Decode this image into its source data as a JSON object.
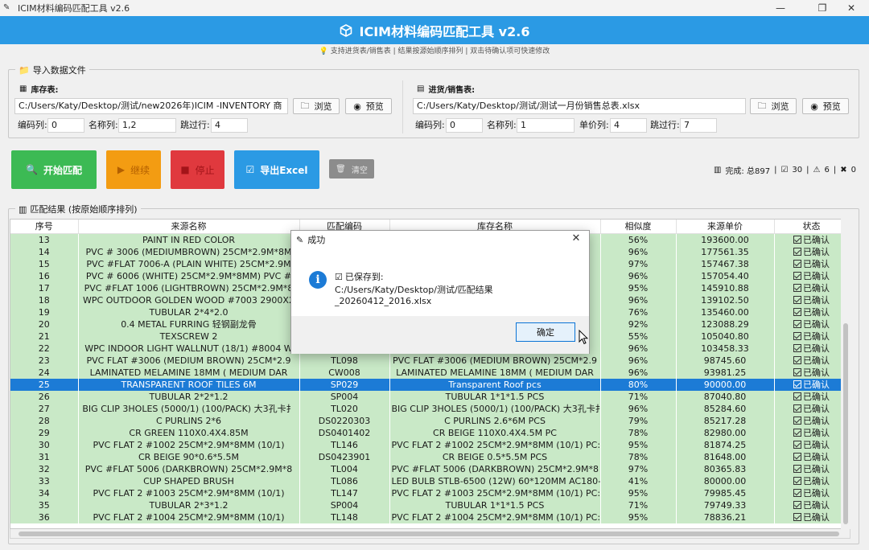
{
  "window": {
    "title": "ICIM材料编码匹配工具 v2.6",
    "minimize": "—",
    "maximize": "❐",
    "close": "✕"
  },
  "header": {
    "title": "ICIM材料编码匹配工具 v2.6",
    "subtitle": "💡 支持进货表/销售表 | 结果按源始顺序排列 | 双击待确认项可快速修改",
    "accent_color": "#2b9ae4"
  },
  "import": {
    "group_title": "导入数据文件",
    "inventory": {
      "label": "库存表:",
      "path": "C:/Users/Katy/Desktop/测试/new2026年)ICIM -INVENTORY 商",
      "browse": "浏览",
      "preview": "预览",
      "code_col_label": "编码列:",
      "code_col": "0",
      "name_col_label": "名称列:",
      "name_col": "1,2",
      "skip_label": "跳过行:",
      "skip": "4"
    },
    "sales": {
      "label": "进货/销售表:",
      "path": "C:/Users/Katy/Desktop/测试/测试一月份销售总表.xlsx",
      "browse": "浏览",
      "preview": "预览",
      "code_col_label": "编码列:",
      "code_col": "0",
      "name_col_label": "名称列:",
      "name_col": "1",
      "price_col_label": "单价列:",
      "price_col": "4",
      "skip_label": "跳过行:",
      "skip": "7"
    }
  },
  "actions": {
    "start": "开始匹配",
    "continue": "继续",
    "stop": "停止",
    "export": "导出Excel",
    "clear": "清空",
    "colors": {
      "start": "#3cba54",
      "continue": "#f39c12",
      "stop": "#e0393e",
      "export": "#2b9ae4",
      "clear": "#8c8c8c"
    }
  },
  "status": {
    "complete_label": "完成: 总897",
    "confirmed": "30",
    "warning": "6",
    "rejected": "0"
  },
  "results": {
    "group_title": "匹配结果 (按原始顺序排列)",
    "columns": [
      "序号",
      "来源名称",
      "匹配编码",
      "库存名称",
      "相似度",
      "来源单价",
      "状态"
    ],
    "status_text": "已确认",
    "rows": [
      [
        "13",
        "PAINT IN RED COLOR",
        "",
        "",
        "56%",
        "193600.00"
      ],
      [
        "14",
        "PVC # 3006 (MEDIUMBROWN) 25CM*2.9M*8M",
        "",
        "",
        "96%",
        "177561.35"
      ],
      [
        "15",
        "PVC #FLAT 7006-A (PLAIN WHITE) 25CM*2.9M",
        "",
        "",
        "97%",
        "157467.38"
      ],
      [
        "16",
        "PVC # 6006 (WHITE) 25CM*2.9M*8MM)  PVC #",
        "",
        "",
        "96%",
        "157054.40"
      ],
      [
        "17",
        "PVC #FLAT 1006 (LIGHTBROWN) 25CM*2.9M*8",
        "",
        "",
        "95%",
        "145910.88"
      ],
      [
        "18",
        "WPC OUTDOOR GOLDEN WOOD #7003 2900X2",
        "",
        "",
        "96%",
        "139102.50"
      ],
      [
        "19",
        "TUBULAR 2*4*2.0",
        "",
        "",
        "76%",
        "135460.00"
      ],
      [
        "20",
        "0.4 METAL FURRING  轻钢副龙骨",
        "",
        "",
        "92%",
        "123088.29"
      ],
      [
        "21",
        "TEXSCREW 2",
        "",
        "",
        "55%",
        "105040.80"
      ],
      [
        "22",
        "WPC INDOOR LIGHT WALLNUT (18/1) #8004  W",
        "",
        "",
        "96%",
        "103458.33"
      ],
      [
        "23",
        "PVC  FLAT #3006 (MEDIUM BROWN) 25CM*2.9",
        "TL098",
        "PVC  FLAT #3006 (MEDIUM BROWN) 25CM*2.9",
        "96%",
        "98745.60"
      ],
      [
        "24",
        "LAMINATED MELAMINE 18MM ( MEDIUM DAR",
        "CW008",
        "LAMINATED MELAMINE 18MM ( MEDIUM DAR",
        "96%",
        "93981.25"
      ],
      [
        "25",
        "TRANSPARENT ROOF TILES 6M",
        "SP029",
        "Transparent Roof pcs",
        "80%",
        "90000.00"
      ],
      [
        "26",
        "TUBULAR 2*2*1.2",
        "SP004",
        "TUBULAR 1*1*1.5 PCS",
        "71%",
        "87040.80"
      ],
      [
        "27",
        "BIG CLIP 3HOLES (5000/1) (100/PACK)  大3孔卡扌",
        "TL020",
        "BIG CLIP 3HOLES (5000/1) (100/PACK)  大3孔卡扌",
        "96%",
        "85284.60"
      ],
      [
        "28",
        "C PURLINS 2*6",
        "DS0220303",
        "C PURLINS 2.6*6M PCS",
        "79%",
        "85217.28"
      ],
      [
        "29",
        "CR GREEN 110X0.4X4.85M",
        "DS0401402",
        "CR BEIGE 110X0.4X4.5M PC",
        "78%",
        "82980.00"
      ],
      [
        "30",
        "PVC FLAT 2 #1002 25CM*2.9M*8MM (10/1)",
        "TL146",
        "PVC FLAT 2 #1002 25CM*2.9M*8MM (10/1) PC:",
        "95%",
        "81874.25"
      ],
      [
        "31",
        "CR BEIGE 90*0.6*5.5M",
        "DS0423901",
        "CR BEIGE 0.5*5.5M PCS",
        "78%",
        "81648.00"
      ],
      [
        "32",
        "PVC #FLAT 5006 (DARKBROWN) 25CM*2.9M*8",
        "TL004",
        "PVC #FLAT 5006 (DARKBROWN) 25CM*2.9M*8",
        "97%",
        "80365.83"
      ],
      [
        "33",
        "CUP SHAPED BRUSH",
        "TL086",
        "LED BULB STLB-6500 (12W) 60*120MM AC180-",
        "41%",
        "80000.00"
      ],
      [
        "34",
        "PVC FLAT 2 #1003 25CM*2.9M*8MM (10/1)",
        "TL147",
        "PVC FLAT 2 #1003 25CM*2.9M*8MM (10/1) PC:",
        "95%",
        "79985.45"
      ],
      [
        "35",
        "TUBULAR 2*3*1.2",
        "SP004",
        "TUBULAR 1*1*1.5 PCS",
        "71%",
        "79749.33"
      ],
      [
        "36",
        "PVC FLAT 2 #1004 25CM*2.9M*8MM (10/1)",
        "TL148",
        "PVC FLAT 2 #1004 25CM*2.9M*8MM (10/1) PC:",
        "95%",
        "78836.21"
      ]
    ],
    "selected_row": "25",
    "row_color": "#c9e9c7",
    "selected_color": "#1c7bd6"
  },
  "dialog": {
    "title": "成功",
    "close": "✕",
    "saved_label": "已保存到:",
    "saved_path": "C:/Users/Katy/Desktop/测试/匹配结果_20260412_2016.xlsx",
    "ok": "确定"
  }
}
